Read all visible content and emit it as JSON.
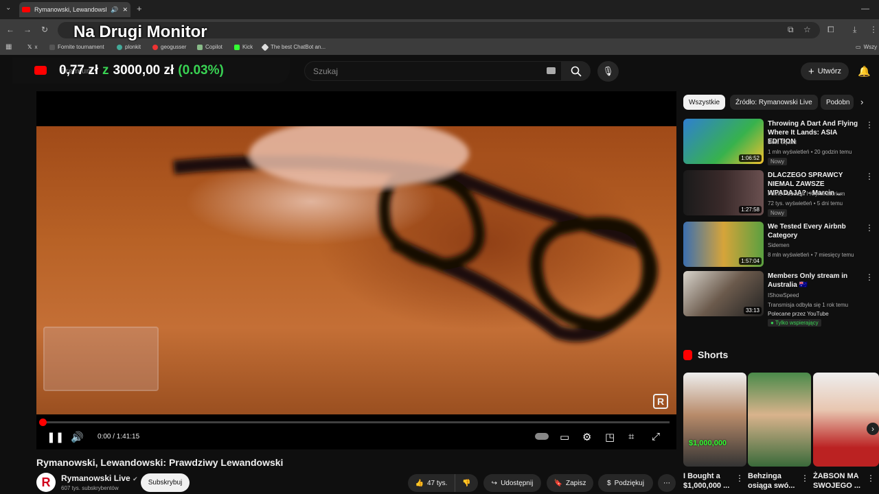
{
  "browser": {
    "tab_title": "Rymanowski, Lewandowski",
    "bookmarks": [
      "x",
      "Fornite tournament",
      "plonkit",
      "geogusser",
      "Copilot",
      "Kick",
      "The best ChatBot an..."
    ],
    "bookmarks_right": "Wszy"
  },
  "overlay": {
    "title": "Na Drugi Monitor",
    "money_current": "0,77 zł",
    "money_of": "z",
    "money_goal": "3000,00 zł",
    "money_pct": "(0.03%)"
  },
  "header": {
    "logo_text": "Premium",
    "search_placeholder": "Szukaj",
    "create_label": "Utwórz"
  },
  "player": {
    "time": "0:00 / 1:41:15",
    "progress": 0.0
  },
  "video": {
    "title": "Rymanowski, Lewandowski: Prawdziwy Lewandowski",
    "channel": "Rymanowski Live",
    "subs": "607 tys. subskrybentów",
    "subscribe": "Subskrybuj",
    "likes": "47 tys.",
    "share": "Udostępnij",
    "save": "Zapisz",
    "thanks": "Podziękuj"
  },
  "sidebar": {
    "chips": [
      "Wszystkie",
      "Źródło: Rymanowski Live",
      "Podobn"
    ],
    "recs": [
      {
        "title": "Throwing A Dart And Flying Where It Lands: ASIA EDITION",
        "channel": "Beta Squad",
        "meta": "1 mln wyświetleń • 20 godzin temu",
        "badge": "Nowy",
        "duration": "1:06:52"
      },
      {
        "title": "DLACZEGO SPRAWCY NIEMAL ZAWSZE WPADAJĄ? - Marcin ...",
        "channel": "Fomo Pødcast. I Kryminatorium",
        "meta": "72 tys. wyświetleń • 5 dni temu",
        "badge": "Nowy",
        "duration": "1:27:58"
      },
      {
        "title": "We Tested Every Airbnb Category",
        "channel": "Sidemen",
        "meta": "8 mln wyświetleń • 7 miesięcy temu",
        "duration": "1:57:04"
      },
      {
        "title": "Members Only stream in Australia 🇦🇺",
        "channel": "IShowSpeed",
        "meta": "Transmisja odbyła się 1 rok temu",
        "extra": "Polecane przez YouTube",
        "members": "Tylko wspierający",
        "duration": "33:13"
      }
    ],
    "shorts_heading": "Shorts",
    "shorts": [
      {
        "title": "I Bought a $1,000,000 ...",
        "overlay": "$1,000,000"
      },
      {
        "title": "Behzinga osiąga swó..."
      },
      {
        "title": "ŻABSON MA SWOJEGO ..."
      }
    ]
  },
  "colors": {
    "accent": "#ff0000",
    "money_green": "#39d353"
  }
}
